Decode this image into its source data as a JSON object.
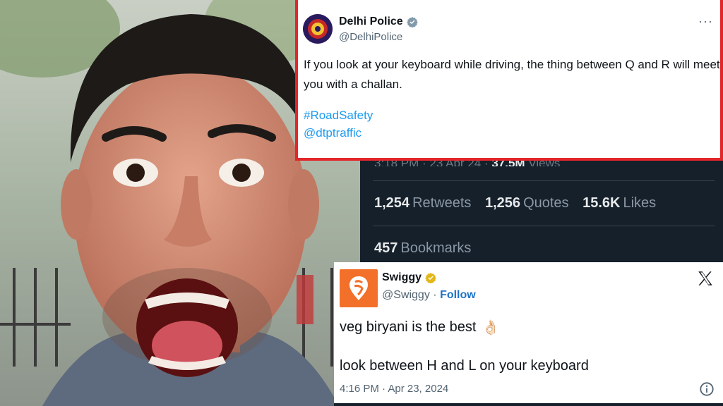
{
  "delhi_tweet": {
    "name": "Delhi Police",
    "handle": "@DelhiPolice",
    "more": "···",
    "text": "If you look at your keyboard while driving, the thing between Q and R will meet you with a challan.",
    "hashtag": "#RoadSafety",
    "mention": "@dtptraffic",
    "colors": {
      "border": "#e3262a",
      "link": "#1d9bf0"
    }
  },
  "stats_panel": {
    "timestamp": "3:18 PM · 23 Apr 24 ·",
    "views_count": "37.5M",
    "views_label": "Views",
    "retweets_count": "1,254",
    "retweets_label": "Retweets",
    "quotes_count": "1,256",
    "quotes_label": "Quotes",
    "likes_count": "15.6K",
    "likes_label": "Likes",
    "bookmarks_count": "457",
    "bookmarks_label": "Bookmarks",
    "colors": {
      "background": "#15202b"
    }
  },
  "swiggy_tweet": {
    "name": "Swiggy",
    "handle": "@Swiggy",
    "separator": "·",
    "follow_label": "Follow",
    "text1": "veg biryani is the best",
    "emoji": "👌🏻",
    "text2": "look between H and L on your keyboard",
    "timestamp": "4:16 PM · Apr 23, 2024",
    "colors": {
      "brand": "#f2702a",
      "follow": "#1d73c8"
    }
  }
}
